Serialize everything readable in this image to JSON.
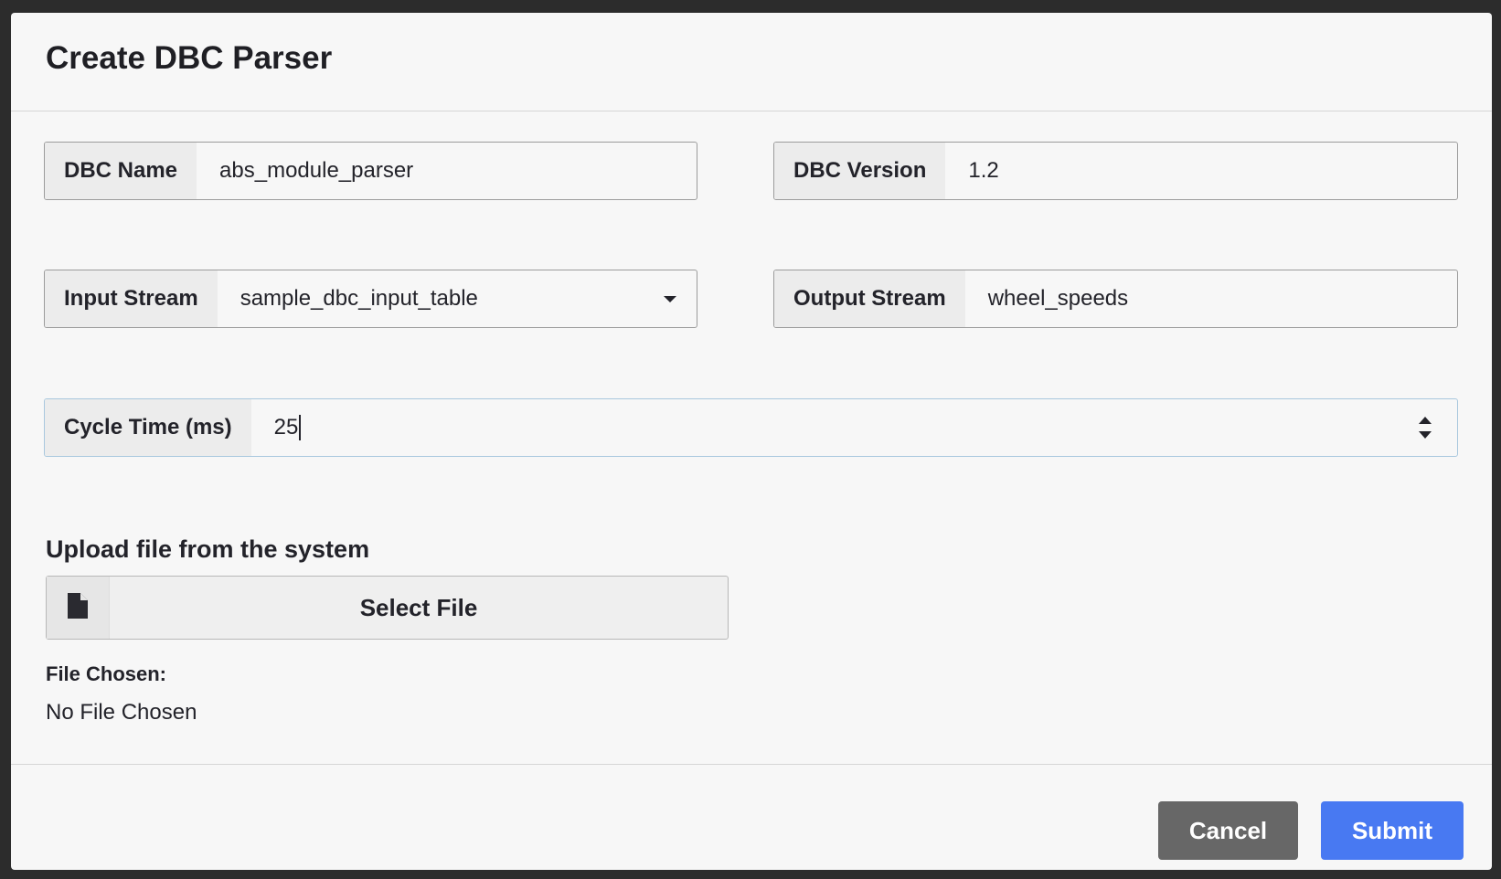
{
  "modal": {
    "title": "Create DBC Parser"
  },
  "fields": {
    "dbc_name": {
      "label": "DBC Name",
      "value": "abs_module_parser"
    },
    "dbc_version": {
      "label": "DBC Version",
      "value": "1.2"
    },
    "input_stream": {
      "label": "Input Stream",
      "value": "sample_dbc_input_table"
    },
    "output_stream": {
      "label": "Output Stream",
      "value": "wheel_speeds"
    },
    "cycle_time": {
      "label": "Cycle Time (ms)",
      "value": "25"
    }
  },
  "upload": {
    "heading": "Upload file from the system",
    "button_label": "Select File",
    "chosen_label": "File Chosen:",
    "chosen_value": "No File Chosen",
    "icon": "file-icon"
  },
  "footer": {
    "cancel_label": "Cancel",
    "submit_label": "Submit"
  },
  "colors": {
    "submit": "#4879f2",
    "cancel": "#676767",
    "background": "#f7f7f7"
  }
}
